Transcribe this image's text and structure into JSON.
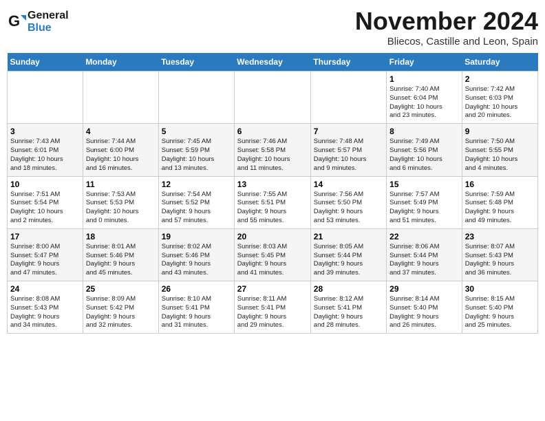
{
  "header": {
    "logo_line1": "General",
    "logo_line2": "Blue",
    "month_title": "November 2024",
    "location": "Bliecos, Castille and Leon, Spain"
  },
  "days_of_week": [
    "Sunday",
    "Monday",
    "Tuesday",
    "Wednesday",
    "Thursday",
    "Friday",
    "Saturday"
  ],
  "weeks": [
    [
      {
        "day": "",
        "info": ""
      },
      {
        "day": "",
        "info": ""
      },
      {
        "day": "",
        "info": ""
      },
      {
        "day": "",
        "info": ""
      },
      {
        "day": "",
        "info": ""
      },
      {
        "day": "1",
        "info": "Sunrise: 7:40 AM\nSunset: 6:04 PM\nDaylight: 10 hours\nand 23 minutes."
      },
      {
        "day": "2",
        "info": "Sunrise: 7:42 AM\nSunset: 6:03 PM\nDaylight: 10 hours\nand 20 minutes."
      }
    ],
    [
      {
        "day": "3",
        "info": "Sunrise: 7:43 AM\nSunset: 6:01 PM\nDaylight: 10 hours\nand 18 minutes."
      },
      {
        "day": "4",
        "info": "Sunrise: 7:44 AM\nSunset: 6:00 PM\nDaylight: 10 hours\nand 16 minutes."
      },
      {
        "day": "5",
        "info": "Sunrise: 7:45 AM\nSunset: 5:59 PM\nDaylight: 10 hours\nand 13 minutes."
      },
      {
        "day": "6",
        "info": "Sunrise: 7:46 AM\nSunset: 5:58 PM\nDaylight: 10 hours\nand 11 minutes."
      },
      {
        "day": "7",
        "info": "Sunrise: 7:48 AM\nSunset: 5:57 PM\nDaylight: 10 hours\nand 9 minutes."
      },
      {
        "day": "8",
        "info": "Sunrise: 7:49 AM\nSunset: 5:56 PM\nDaylight: 10 hours\nand 6 minutes."
      },
      {
        "day": "9",
        "info": "Sunrise: 7:50 AM\nSunset: 5:55 PM\nDaylight: 10 hours\nand 4 minutes."
      }
    ],
    [
      {
        "day": "10",
        "info": "Sunrise: 7:51 AM\nSunset: 5:54 PM\nDaylight: 10 hours\nand 2 minutes."
      },
      {
        "day": "11",
        "info": "Sunrise: 7:53 AM\nSunset: 5:53 PM\nDaylight: 10 hours\nand 0 minutes."
      },
      {
        "day": "12",
        "info": "Sunrise: 7:54 AM\nSunset: 5:52 PM\nDaylight: 9 hours\nand 57 minutes."
      },
      {
        "day": "13",
        "info": "Sunrise: 7:55 AM\nSunset: 5:51 PM\nDaylight: 9 hours\nand 55 minutes."
      },
      {
        "day": "14",
        "info": "Sunrise: 7:56 AM\nSunset: 5:50 PM\nDaylight: 9 hours\nand 53 minutes."
      },
      {
        "day": "15",
        "info": "Sunrise: 7:57 AM\nSunset: 5:49 PM\nDaylight: 9 hours\nand 51 minutes."
      },
      {
        "day": "16",
        "info": "Sunrise: 7:59 AM\nSunset: 5:48 PM\nDaylight: 9 hours\nand 49 minutes."
      }
    ],
    [
      {
        "day": "17",
        "info": "Sunrise: 8:00 AM\nSunset: 5:47 PM\nDaylight: 9 hours\nand 47 minutes."
      },
      {
        "day": "18",
        "info": "Sunrise: 8:01 AM\nSunset: 5:46 PM\nDaylight: 9 hours\nand 45 minutes."
      },
      {
        "day": "19",
        "info": "Sunrise: 8:02 AM\nSunset: 5:46 PM\nDaylight: 9 hours\nand 43 minutes."
      },
      {
        "day": "20",
        "info": "Sunrise: 8:03 AM\nSunset: 5:45 PM\nDaylight: 9 hours\nand 41 minutes."
      },
      {
        "day": "21",
        "info": "Sunrise: 8:05 AM\nSunset: 5:44 PM\nDaylight: 9 hours\nand 39 minutes."
      },
      {
        "day": "22",
        "info": "Sunrise: 8:06 AM\nSunset: 5:44 PM\nDaylight: 9 hours\nand 37 minutes."
      },
      {
        "day": "23",
        "info": "Sunrise: 8:07 AM\nSunset: 5:43 PM\nDaylight: 9 hours\nand 36 minutes."
      }
    ],
    [
      {
        "day": "24",
        "info": "Sunrise: 8:08 AM\nSunset: 5:43 PM\nDaylight: 9 hours\nand 34 minutes."
      },
      {
        "day": "25",
        "info": "Sunrise: 8:09 AM\nSunset: 5:42 PM\nDaylight: 9 hours\nand 32 minutes."
      },
      {
        "day": "26",
        "info": "Sunrise: 8:10 AM\nSunset: 5:41 PM\nDaylight: 9 hours\nand 31 minutes."
      },
      {
        "day": "27",
        "info": "Sunrise: 8:11 AM\nSunset: 5:41 PM\nDaylight: 9 hours\nand 29 minutes."
      },
      {
        "day": "28",
        "info": "Sunrise: 8:12 AM\nSunset: 5:41 PM\nDaylight: 9 hours\nand 28 minutes."
      },
      {
        "day": "29",
        "info": "Sunrise: 8:14 AM\nSunset: 5:40 PM\nDaylight: 9 hours\nand 26 minutes."
      },
      {
        "day": "30",
        "info": "Sunrise: 8:15 AM\nSunset: 5:40 PM\nDaylight: 9 hours\nand 25 minutes."
      }
    ]
  ]
}
